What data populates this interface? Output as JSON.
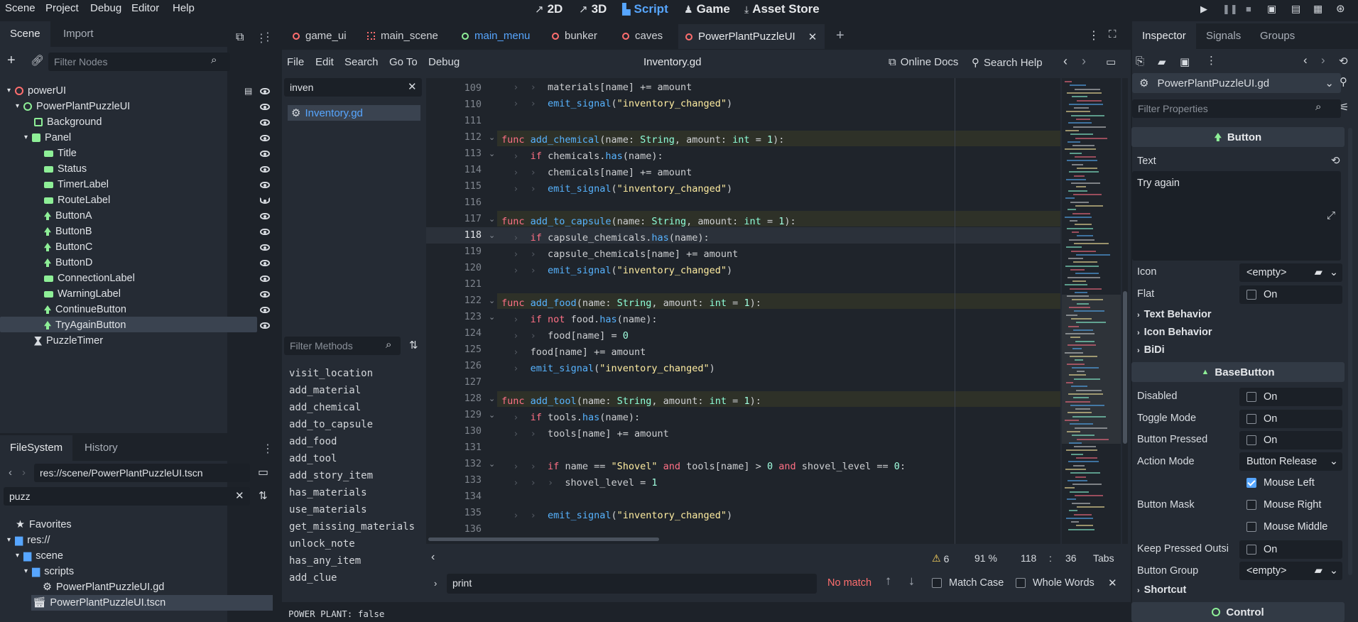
{
  "menu": [
    "Scene",
    "Project",
    "Debug",
    "Editor",
    "Help"
  ],
  "modes": [
    "2D",
    "3D",
    "Script",
    "Game",
    "Asset Store"
  ],
  "scene_dock": {
    "tabs": [
      "Scene",
      "Import"
    ],
    "filter_placeholder": "Filter Nodes",
    "nodes": [
      "powerUI",
      "PowerPlantPuzzleUI",
      "Background",
      "Panel",
      "Title",
      "Status",
      "TimerLabel",
      "RouteLabel",
      "ButtonA",
      "ButtonB",
      "ButtonC",
      "ButtonD",
      "ConnectionLabel",
      "WarningLabel",
      "ContinueButton",
      "TryAgainButton",
      "PuzzleTimer"
    ]
  },
  "filesystem": {
    "tabs": [
      "FileSystem",
      "History"
    ],
    "path": "res://scene/PowerPlantPuzzleUI.tscn",
    "search": "puzz",
    "tree": [
      "Favorites",
      "res://",
      "scene",
      "scripts",
      "PowerPlantPuzzleUI.gd",
      "PowerPlantPuzzleUI.tscn"
    ]
  },
  "script_tabs": [
    "game_ui",
    "main_scene",
    "main_menu",
    "bunker",
    "caves",
    "PowerPlantPuzzleUI"
  ],
  "script_menu": [
    "File",
    "Edit",
    "Search",
    "Go To",
    "Debug"
  ],
  "script_file": "Inventory.gd",
  "online_docs": "Online Docs",
  "search_help": "Search Help",
  "script_filter": "inven",
  "script_list": [
    "Inventory.gd"
  ],
  "methods_placeholder": "Filter Methods",
  "methods": [
    "visit_location",
    "add_material",
    "add_chemical",
    "add_to_capsule",
    "add_food",
    "add_tool",
    "add_story_item",
    "has_materials",
    "use_materials",
    "get_missing_materials",
    "unlock_note",
    "has_any_item",
    "add_clue"
  ],
  "line_numbers": [
    "109",
    "110",
    "111",
    "112",
    "113",
    "114",
    "115",
    "116",
    "117",
    "118",
    "119",
    "120",
    "121",
    "122",
    "123",
    "124",
    "125",
    "126",
    "127",
    "128",
    "129",
    "130",
    "131",
    "132",
    "133",
    "134",
    "135",
    "136"
  ],
  "status": {
    "warnings": "6",
    "zoom": "91 %",
    "line": "118",
    "sep": ":",
    "col": "36",
    "indent": "Tabs"
  },
  "find": {
    "value": "print",
    "result": "No match",
    "match_case": "Match Case",
    "whole_words": "Whole Words"
  },
  "output": "POWER PLANT: false",
  "inspector": {
    "tabs": [
      "Inspector",
      "Signals",
      "Groups"
    ],
    "resource": "PowerPlantPuzzleUI.gd",
    "filter_placeholder": "Filter Properties",
    "section_button": "Button",
    "text_label": "Text",
    "text_value": "Try again",
    "icon_label": "Icon",
    "icon_value": "<empty>",
    "flat_label": "Flat",
    "on": "On",
    "groups": [
      "Text Behavior",
      "Icon Behavior",
      "BiDi"
    ],
    "section_basebutton": "BaseButton",
    "disabled_label": "Disabled",
    "toggle_label": "Toggle Mode",
    "pressed_label": "Button Pressed",
    "action_label": "Action Mode",
    "action_value": "Button Release",
    "mask_label": "Button Mask",
    "mask_options": [
      "Mouse Left",
      "Mouse Right",
      "Mouse Middle"
    ],
    "keep_label": "Keep Pressed Outsi",
    "group_label": "Button Group",
    "group_value": "<empty>",
    "shortcut": "Shortcut",
    "section_control": "Control"
  }
}
